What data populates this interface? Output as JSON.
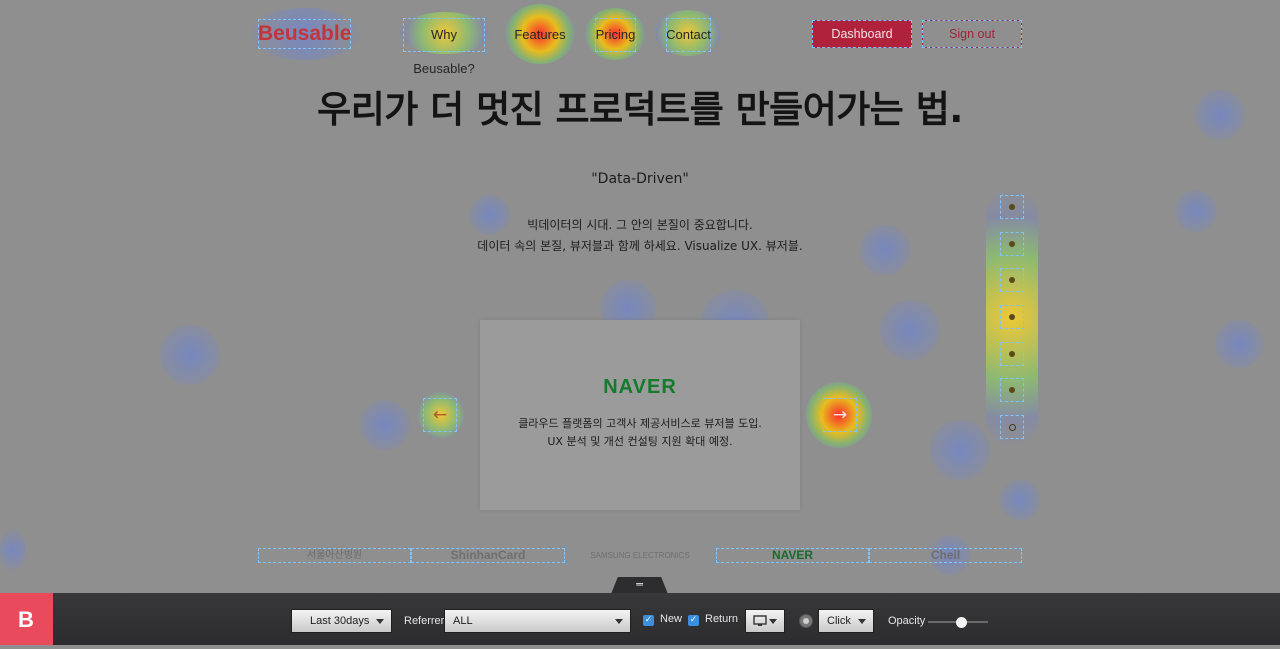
{
  "nav": {
    "logo": "Beusable",
    "links": [
      "Why Beusable?",
      "Features",
      "Pricing",
      "Contact"
    ],
    "dashboard_label": "Dashboard",
    "signout_label": "Sign out"
  },
  "hero": {
    "title": "우리가 더 멋진 프로덕트를 만들어가는 법.",
    "quote": "\"Data-Driven\"",
    "desc_line1": "빅데이터의 시대. 그 안의 본질이 중요합니다.",
    "desc_line2": "데이터 속의 본질, 뷰저블과 함께 하세요. Visualize UX. 뷰저블."
  },
  "slider": {
    "brand": "NAVER",
    "line1": "클라우드 플랫폼의 고객사 제공서비스로 뷰저블 도입.",
    "line2": "UX 분석 및 개선 컨설팅 지원 확대 예정.",
    "prev_icon": "arrow-left-icon",
    "next_icon": "arrow-right-icon",
    "dots_count_visible": 7
  },
  "partners": [
    "서울아산병원",
    "ShinhanCard",
    "SAMSUNG ELECTRONICS",
    "NAVER",
    "Cheil"
  ],
  "toolbar": {
    "handle_icon": "menu-lines-icon",
    "period": "Last 30days",
    "referrer_label": "Referrer",
    "referrer_value": "ALL",
    "new_label": "New",
    "return_label": "Return",
    "device_icon": "monitor-icon",
    "mode_icon": "radio-dot-icon",
    "mode_value": "Click",
    "opacity_label": "Opacity",
    "opacity_value": 0.55
  },
  "colors": {
    "brand_red": "#e94b5c",
    "dashboard_bg": "#b0223b",
    "naver_green": "#147a2c",
    "checkbox_blue": "#3b8fe0"
  }
}
